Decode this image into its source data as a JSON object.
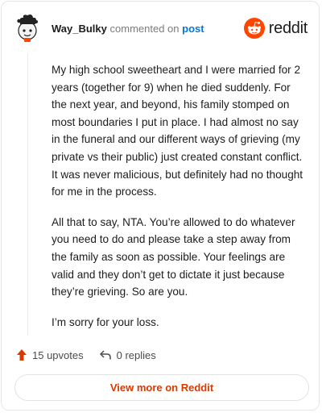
{
  "header": {
    "username": "Way_Bulky",
    "commented_on": "commented on",
    "post_link": "post",
    "brand": "reddit"
  },
  "comment": {
    "paragraphs": [
      "My high school sweetheart and I were married for 2 years (together for 9) when he died suddenly. For the next year, and beyond, his family stomped on most boundaries I put in place. I had almost no say in the funeral and our different ways of grieving (my private vs their public) just created constant conflict. It was never malicious, but definitely had no thought for me in the process.",
      "All that to say, NTA. You’re allowed to do whatever you need to do and please take a step away from the family as soon as possible. Your feelings are valid and they don’t get to dictate it just because they’re grieving. So are you.",
      "I’m sorry for your loss."
    ]
  },
  "actions": {
    "upvotes": "15 upvotes",
    "replies": "0 replies"
  },
  "footer": {
    "view_more": "View more on Reddit"
  },
  "colors": {
    "reddit_orange": "#ff4500",
    "upvote_orange": "#d93a00",
    "link_blue": "#0079d3"
  }
}
